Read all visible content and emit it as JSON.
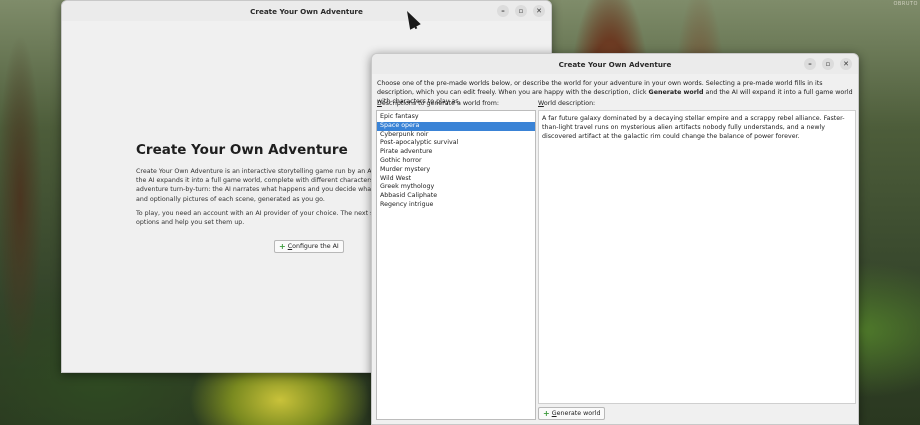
{
  "desktop": {
    "corner_label": "OBRUTO"
  },
  "back_window": {
    "title": "Create Your Own Adventure",
    "heading": "Create Your Own Adventure",
    "paragraph1": "Create Your Own Adventure is an interactive storytelling game run by an AI. Describe a world, and the AI expands it into a full game world, complete with different characters. Then you play the adventure turn-by-turn: the AI narrates what happens and you decide what to do, shaping the story, and optionally pictures of each scene, generated as you go.",
    "paragraph2": "To play, you need an account with an AI provider of your choice. The next screen explains the options and help you set them up.",
    "configure_button": "Configure the AI"
  },
  "front_window": {
    "title": "Create Your Own Adventure",
    "intro_before_bold1": "Choose one of the pre-made worlds below, or describe the world for your adventure in your own words. Selecting a pre-made world fills in its description, which you can edit freely. When you are happy with the description, click ",
    "intro_bold1": "Generate world",
    "intro_after_bold1": " and the AI will expand it into a full game world with characters to play as.",
    "list_label": "Descriptions to generate a world from:",
    "desc_label": "World description:",
    "worlds": [
      "Epic fantasy",
      "Space opera",
      "Cyberpunk noir",
      "Post-apocalyptic survival",
      "Pirate adventure",
      "Gothic horror",
      "Murder mystery",
      "Wild West",
      "Greek mythology",
      "Abbasid Caliphate",
      "Regency intrigue"
    ],
    "selected_index": 1,
    "world_description": "A far future galaxy dominated by a decaying stellar empire and a scrappy rebel alliance. Faster-than-light travel runs on mysterious alien artifacts nobody fully understands, and a newly discovered artifact at the galactic rim could change the balance of power forever.",
    "generate_button": "Generate world"
  },
  "colors": {
    "selection": "#3a83d6",
    "plus_icon": "#3c9a3c"
  }
}
